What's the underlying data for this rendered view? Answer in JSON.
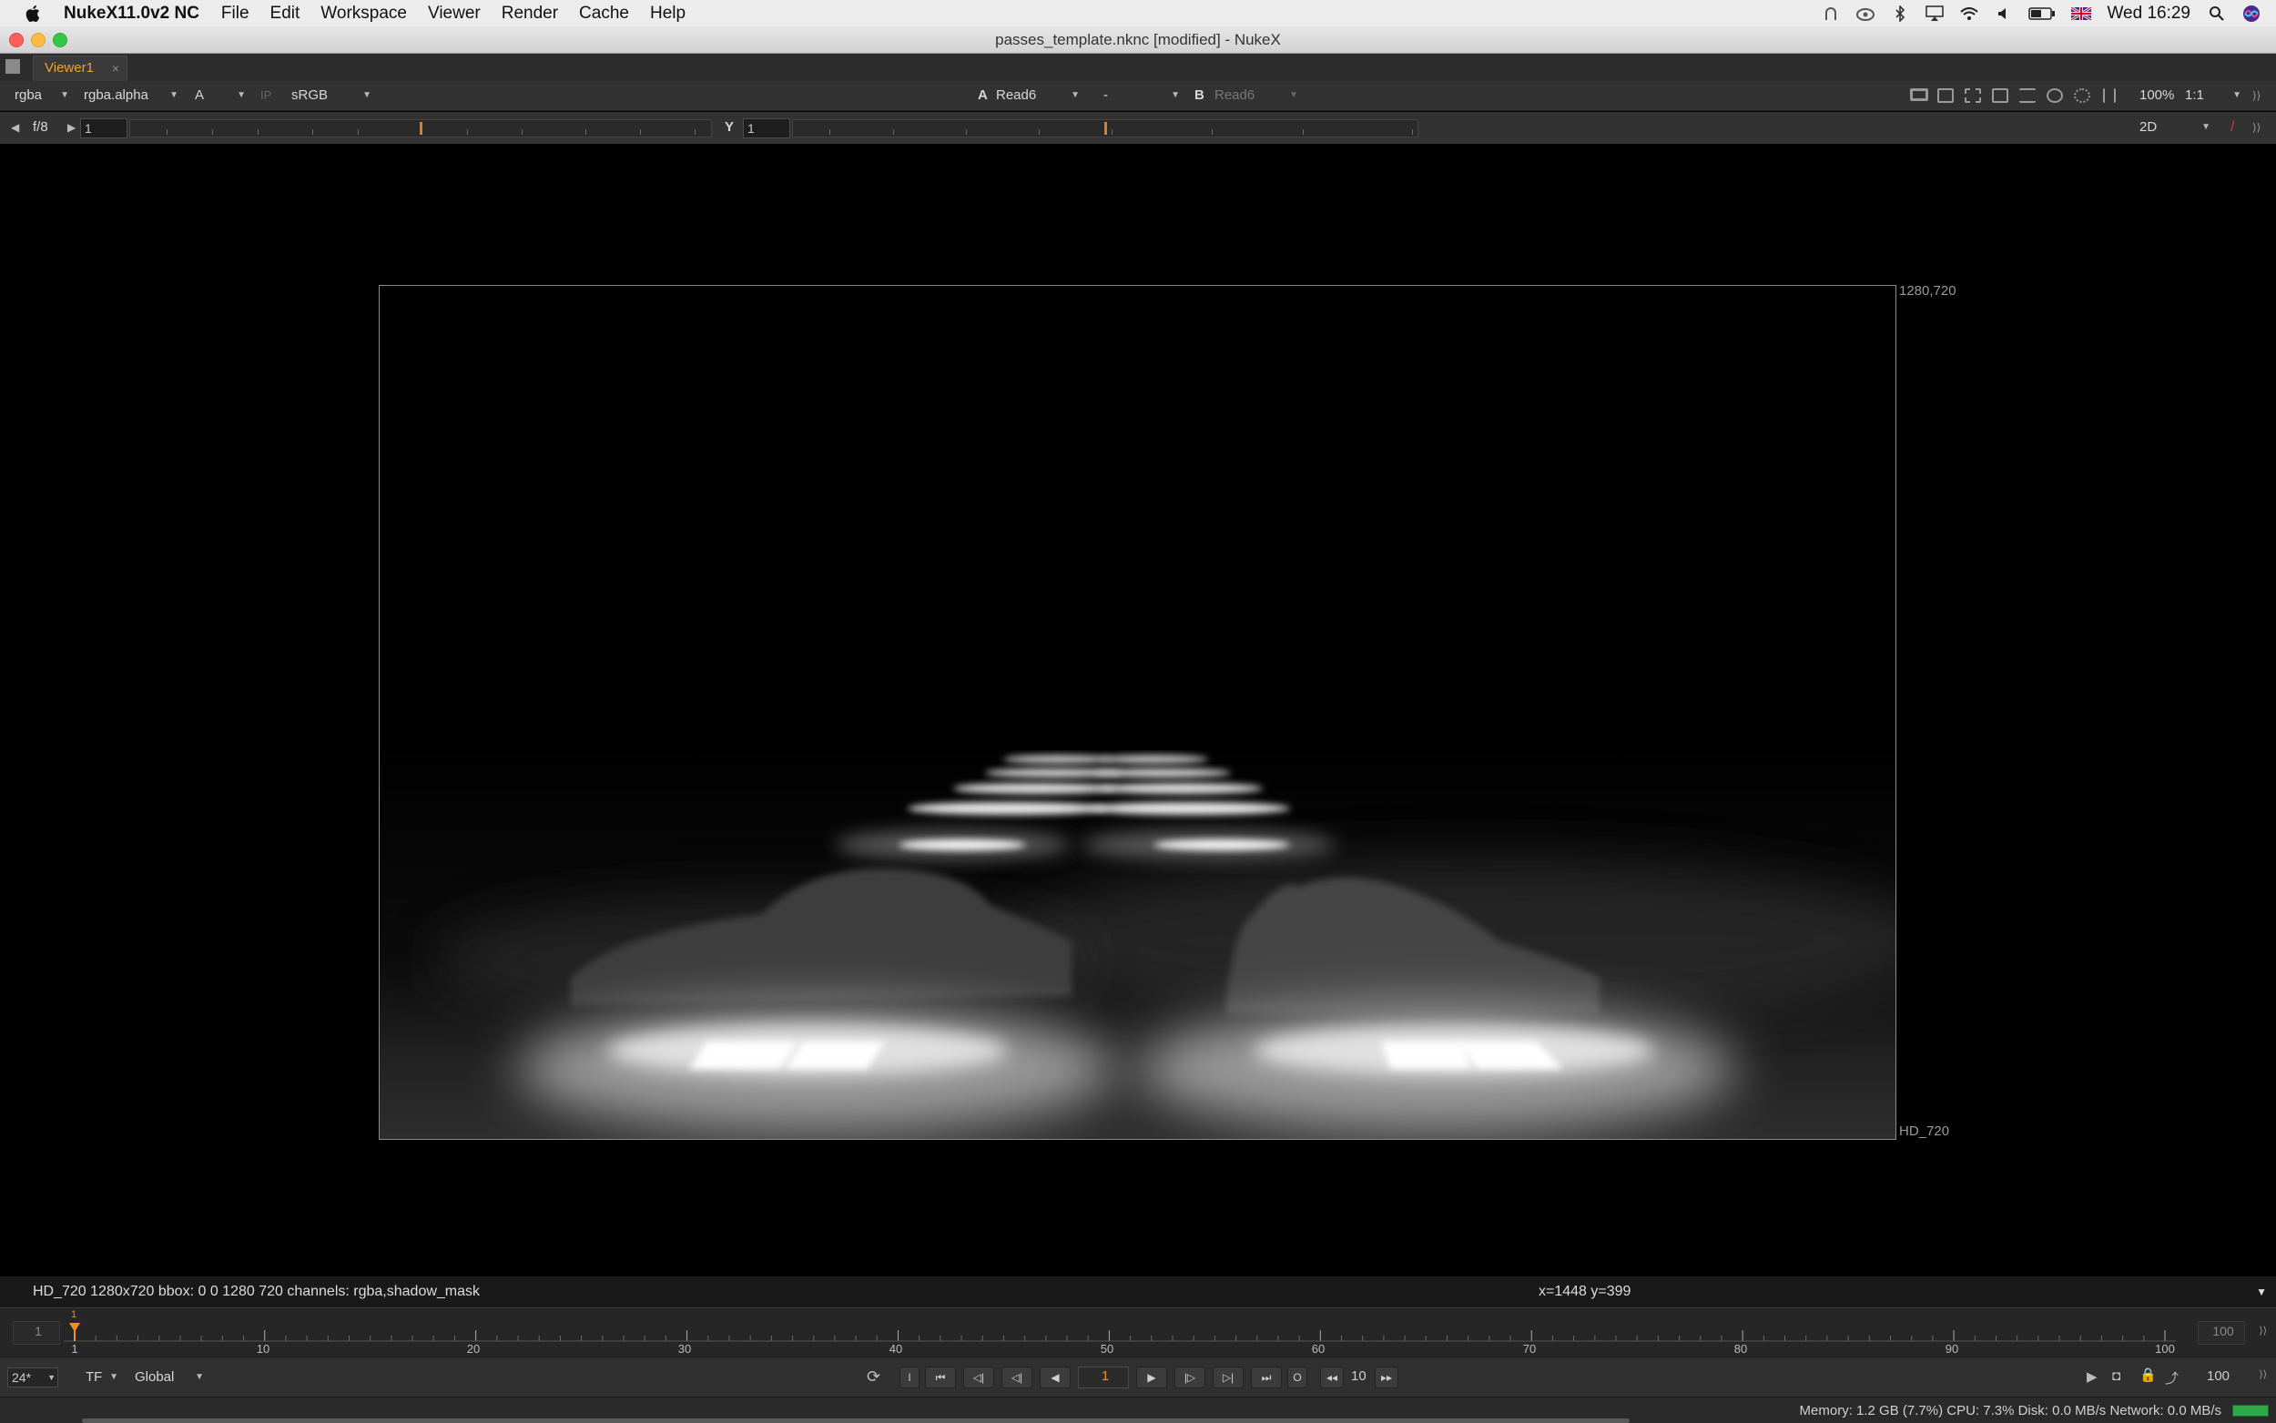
{
  "menubar": {
    "app_name": "NukeX11.0v2 NC",
    "items": [
      "File",
      "Edit",
      "Workspace",
      "Viewer",
      "Render",
      "Cache",
      "Help"
    ],
    "clock": "Wed 16:29"
  },
  "window": {
    "title": "passes_template.nknc [modified] - NukeX"
  },
  "tab": {
    "label": "Viewer1",
    "close": "×"
  },
  "toolbar1": {
    "channels": "rgba",
    "channel_layer": "rgba.alpha",
    "display_channel": "A",
    "ip": "IP",
    "colorspace": "sRGB",
    "a_label": "A",
    "a_input": "Read6",
    "compare_mode": "-",
    "b_label": "B",
    "b_input": "Read6",
    "zoom": "100%",
    "proxy": "1:1"
  },
  "toolbar2": {
    "fstop": "f/8",
    "gain_value": "1",
    "gamma_label": "Y",
    "gamma_value": "1",
    "view_mode": "2D"
  },
  "viewer": {
    "format_label": "HD_720",
    "dimensions_label": "1280,720"
  },
  "infobar": {
    "format_info": "HD_720 1280x720  bbox: 0 0 1280 720 channels: rgba,shadow_mask",
    "cursor_coords": "x=1448 y=399"
  },
  "timeline": {
    "start_frame": "1",
    "end_frame": "100",
    "current_marker": "1",
    "ticks": [
      "1",
      "10",
      "20",
      "30",
      "40",
      "50",
      "60",
      "70",
      "80",
      "90",
      "100"
    ]
  },
  "controls": {
    "fps": "24*",
    "tf": "TF",
    "range_mode": "Global",
    "current_frame": "1",
    "in_btn": "I",
    "out_btn": "O",
    "skip_increment": "10",
    "end_frame": "100"
  },
  "statusbar": {
    "text": "Memory: 1.2 GB (7.7%) CPU: 7.3% Disk: 0.0 MB/s Network: 0.0 MB/s"
  },
  "colors": {
    "accent_orange": "#f0a030",
    "viewer_bg": "#000000",
    "toolbar_bg": "#323232"
  }
}
